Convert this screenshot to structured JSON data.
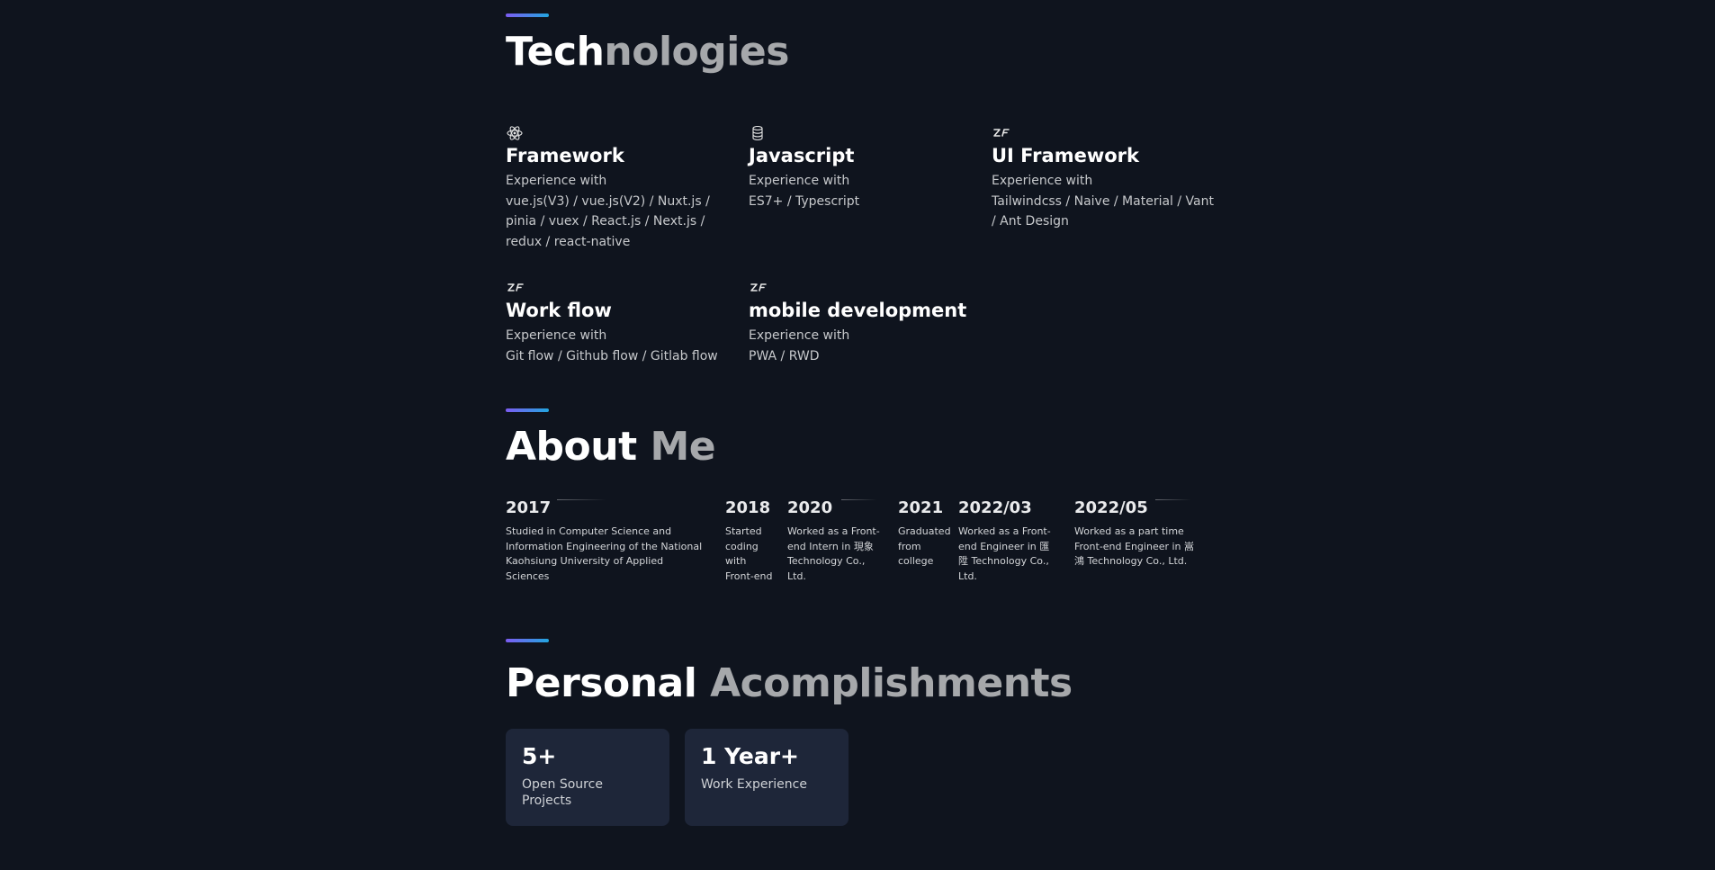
{
  "technologies": {
    "title_part1": "Tech",
    "title_part2": "nologies",
    "items": [
      {
        "icon": "atom-icon",
        "title": "Framework",
        "desc_line1": "Experience with",
        "desc_line2": "vue.js(V3) / vue.js(V2) / Nuxt.js / pinia / vuex / React.js / Next.js / redux / react-native"
      },
      {
        "icon": "database-icon",
        "title": "Javascript",
        "desc_line1": "Experience with",
        "desc_line2": "ES7+ / Typescript"
      },
      {
        "icon": "zf-logo-icon",
        "title": "UI Framework",
        "desc_line1": "Experience with",
        "desc_line2": "Tailwindcss / Naive / Material / Vant / Ant Design"
      },
      {
        "icon": "zf-logo-icon",
        "title": "Work flow",
        "desc_line1": "Experience with",
        "desc_line2": "Git flow / Github flow / Gitlab flow"
      },
      {
        "icon": "zf-logo-icon",
        "title": "mobile development",
        "desc_line1": "Experience with",
        "desc_line2": "PWA / RWD"
      }
    ]
  },
  "about": {
    "title_part1": "About",
    "title_part2": " Me",
    "timeline": [
      {
        "year": "2017",
        "desc": "Studied in Computer Science and Information Engineering of the National Kaohsiung University of Applied Sciences"
      },
      {
        "year": "2018",
        "desc": "Started coding with Front-end"
      },
      {
        "year": "2020",
        "desc": "Worked as a Front-end Intern in 現象 Technology Co., Ltd."
      },
      {
        "year": "2021",
        "desc": "Graduated from college"
      },
      {
        "year": "2022/03",
        "desc": "Worked as a Front-end Engineer in 匯陞 Technology Co., Ltd."
      },
      {
        "year": "2022/05",
        "desc": "Worked as a part time Front-end Engineer in 嵩鴻 Technology Co., Ltd."
      }
    ]
  },
  "accomplishments": {
    "title_part1": "Personal ",
    "title_part2": "Acomplishments",
    "cards": [
      {
        "value": "5+",
        "label": "Open Source Projects"
      },
      {
        "value": "1 Year+",
        "label": "Work Experience"
      }
    ]
  },
  "colors": {
    "background": "#0f141e",
    "card": "#1e2639",
    "accent_start": "#7c5cf2",
    "accent_end": "#22a6e0"
  }
}
